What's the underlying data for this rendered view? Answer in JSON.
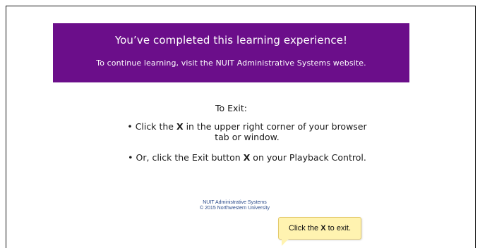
{
  "banner": {
    "title": "You’ve completed this learning experience!",
    "subtitle": "To continue learning, visit the NUIT Administrative Systems website.",
    "background_color": "#6b0e8a"
  },
  "exit": {
    "heading": "To Exit:",
    "bullet_symbol": "•",
    "instruction_1": {
      "before": "Click the ",
      "key": "X",
      "after": " in the upper right corner of your browser tab or window."
    },
    "instruction_2": {
      "before": "Or, click the Exit button ",
      "key": "X",
      "after": " on your Playback Control."
    }
  },
  "footer": {
    "line1": "NUIT Administrative Systems",
    "line2": "© 2015 Northwestern University"
  },
  "tooltip": {
    "before": "Click the ",
    "key": "X",
    "after": " to exit.",
    "background_color": "#fff3b0"
  }
}
